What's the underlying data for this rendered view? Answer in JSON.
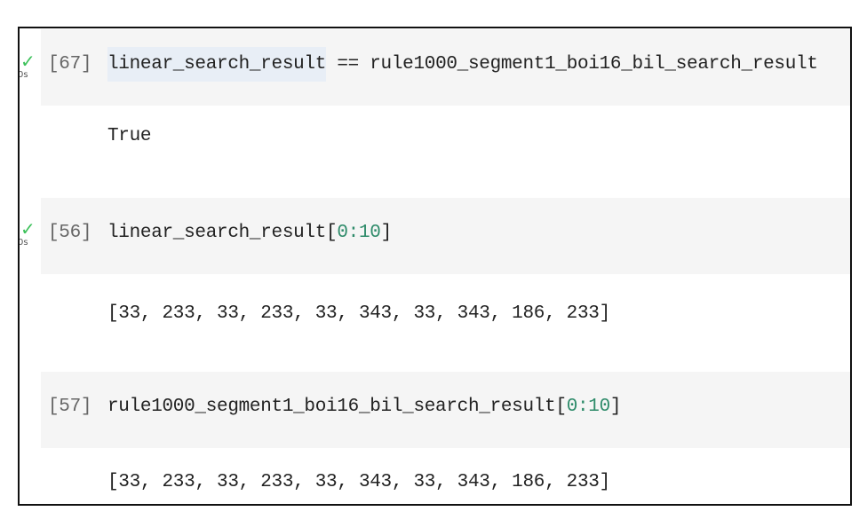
{
  "cells": [
    {
      "prompt": "[67]",
      "status_check": "✓",
      "status_time": "0s",
      "code_highlight": "linear_search_result",
      "code_rest": " == rule1000_segment1_boi16_bil_search_result",
      "output": "True"
    },
    {
      "prompt": "[56]",
      "status_check": "✓",
      "status_time": "0s",
      "code_name": "linear_search_result",
      "code_open": "[",
      "code_slice": "0:10",
      "code_close": "]",
      "output": "[33, 233, 33, 233, 33, 343, 33, 343, 186, 233]"
    },
    {
      "prompt": "[57]",
      "code_name": "rule1000_segment1_boi16_bil_search_result",
      "code_open": "[",
      "code_slice": "0:10",
      "code_close": "]",
      "output": "[33, 233, 33, 233, 33, 343, 33, 343, 186, 233]"
    }
  ],
  "colors": {
    "check": "#3cc15a",
    "number": "#2e8b6a",
    "cell_bg": "#f5f5f5"
  }
}
